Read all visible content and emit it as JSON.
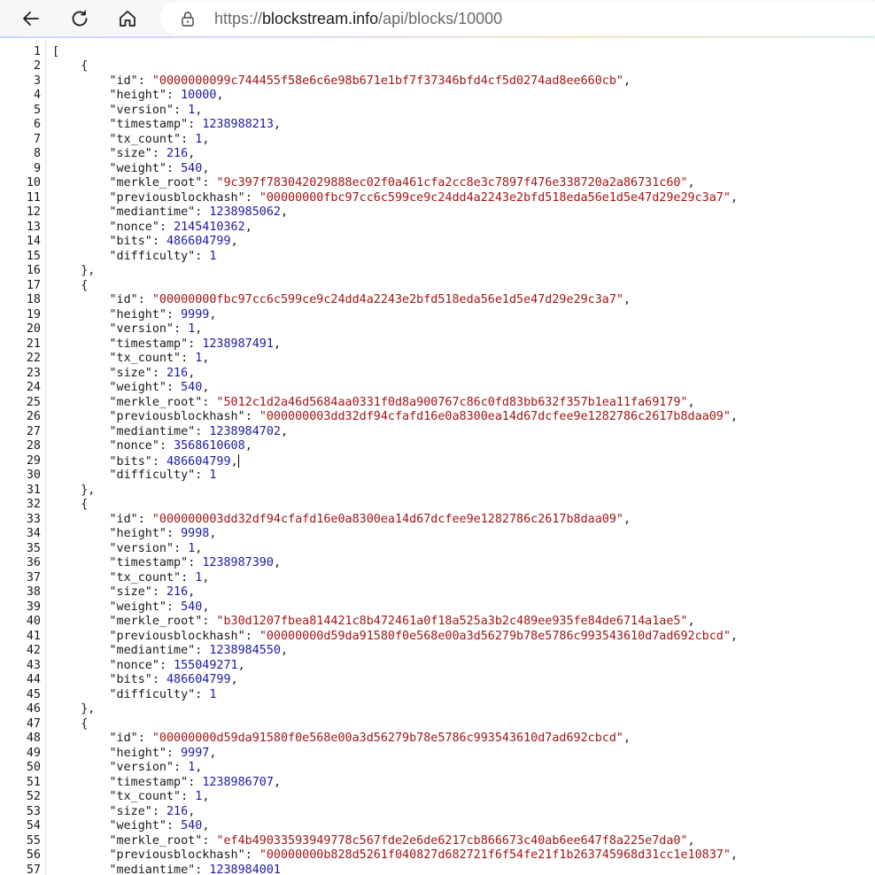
{
  "browser": {
    "url_prefix": "https://",
    "url_domain": "blockstream.info",
    "url_path": "/api/blocks/10000",
    "icons": {
      "back": "arrow-left-icon",
      "reload": "reload-icon",
      "home": "home-icon",
      "lock": "lock-icon"
    }
  },
  "viewer": {
    "first_line_number": 1,
    "caret_after_line": 29,
    "blocks": [
      {
        "id": "0000000099c744455f58e6c6e98b671e1bf7f37346bfd4cf5d0274ad8ee660cb",
        "height": 10000,
        "version": 1,
        "timestamp": 1238988213,
        "tx_count": 1,
        "size": 216,
        "weight": 540,
        "merkle_root": "9c397f783042029888ec02f0a461cfa2cc8e3c7897f476e338720a2a86731c60",
        "previousblockhash": "00000000fbc97cc6c599ce9c24dd4a2243e2bfd518eda56e1d5e47d29e29c3a7",
        "mediantime": 1238985062,
        "nonce": 2145410362,
        "bits": 486604799,
        "difficulty": 1
      },
      {
        "id": "00000000fbc97cc6c599ce9c24dd4a2243e2bfd518eda56e1d5e47d29e29c3a7",
        "height": 9999,
        "version": 1,
        "timestamp": 1238987491,
        "tx_count": 1,
        "size": 216,
        "weight": 540,
        "merkle_root": "5012c1d2a46d5684aa0331f0d8a900767c86c0fd83bb632f357b1ea11fa69179",
        "previousblockhash": "000000003dd32df94cfafd16e0a8300ea14d67dcfee9e1282786c2617b8daa09",
        "mediantime": 1238984702,
        "nonce": 3568610608,
        "bits": 486604799,
        "difficulty": 1
      },
      {
        "id": "000000003dd32df94cfafd16e0a8300ea14d67dcfee9e1282786c2617b8daa09",
        "height": 9998,
        "version": 1,
        "timestamp": 1238987390,
        "tx_count": 1,
        "size": 216,
        "weight": 540,
        "merkle_root": "b30d1207fbea814421c8b472461a0f18a525a3b2c489ee935fe84de6714a1ae5",
        "previousblockhash": "00000000d59da91580f0e568e00a3d56279b78e5786c993543610d7ad692cbcd",
        "mediantime": 1238984550,
        "nonce": 155049271,
        "bits": 486604799,
        "difficulty": 1
      },
      {
        "id": "00000000d59da91580f0e568e00a3d56279b78e5786c993543610d7ad692cbcd",
        "height": 9997,
        "version": 1,
        "timestamp": 1238986707,
        "tx_count": 1,
        "size": 216,
        "weight": 540,
        "merkle_root": "ef4b49033593949778c567fde2e6de6217cb866673c40ab6ee647f8a225e7da0",
        "previousblockhash": "00000000b828d5261f040827d682721f6f54fe21f1b263745968d31cc1e10837",
        "mediantime": 1238984001
      }
    ],
    "colors": {
      "string": "#a31515",
      "number": "#1a1aa6",
      "key": "#1a1a1a"
    }
  }
}
